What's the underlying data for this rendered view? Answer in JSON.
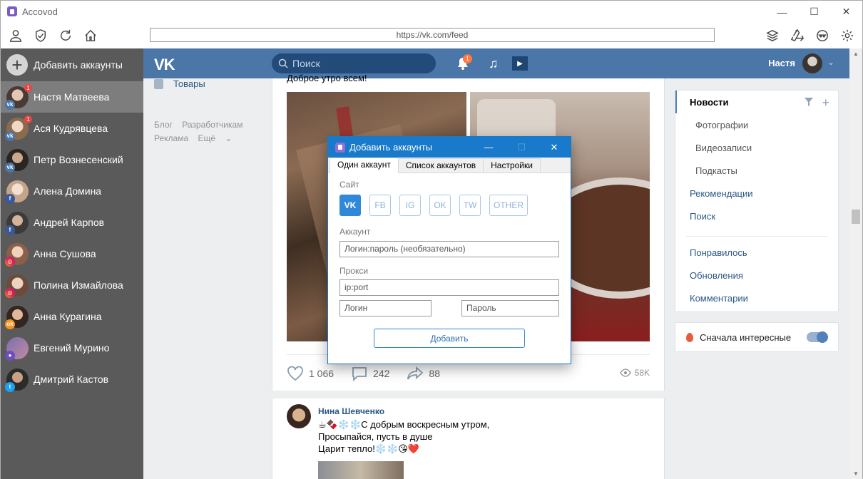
{
  "window": {
    "title": "Accovod"
  },
  "toolbar": {
    "url": "https://vk.com/feed"
  },
  "sidebar": {
    "add_label": "Добавить аккаунты",
    "accounts": [
      {
        "name": "Настя Матвеева",
        "network": "VK",
        "badge": "1"
      },
      {
        "name": "Ася Кудрявцева",
        "network": "VK",
        "badge": "1"
      },
      {
        "name": "Петр Вознесенский",
        "network": "VK"
      },
      {
        "name": "Алена Домина",
        "network": "FB"
      },
      {
        "name": "Андрей Карпов",
        "network": "FB"
      },
      {
        "name": "Анна Сушова",
        "network": "IG"
      },
      {
        "name": "Полина Измайлова",
        "network": "IG"
      },
      {
        "name": "Анна Курагина",
        "network": "OK"
      },
      {
        "name": "Евгений Мурино",
        "network": "OTHER"
      },
      {
        "name": "Дмитрий Кастов",
        "network": "TW"
      }
    ]
  },
  "vk": {
    "search_placeholder": "Поиск",
    "notif_count": "1",
    "user_name": "Настя",
    "left_nav": {
      "goods": "Товары",
      "links": [
        "Блог",
        "Разработчикам",
        "Реклама",
        "Ещё"
      ]
    },
    "post1": {
      "text": "Доброе утро всем!",
      "likes": "1 066",
      "comments": "242",
      "shares": "88",
      "views": "58K"
    },
    "post2": {
      "author": "Нина Шевченко",
      "text": "☕🍫❄️❄️С добрым воскресным утром,\nПросыпайся, пусть в душе\nЦарит тепло!❄️❄️😘❤️"
    },
    "right_menu": {
      "news": "Новости",
      "subs": [
        "Фотографии",
        "Видеозаписи",
        "Подкасты"
      ],
      "main": [
        "Рекомендации",
        "Поиск"
      ],
      "other": [
        "Понравилось",
        "Обновления",
        "Комментарии"
      ]
    },
    "interesting_label": "Сначала интересные"
  },
  "dialog": {
    "title": "Добавить аккаунты",
    "tabs": [
      "Один аккаунт",
      "Список аккаунтов",
      "Настройки"
    ],
    "site_label": "Сайт",
    "sites": [
      "VK",
      "FB",
      "IG",
      "OK",
      "TW",
      "OTHER"
    ],
    "account_label": "Аккаунт",
    "account_placeholder": "Логин:пароль (необязательно)",
    "proxy_label": "Прокси",
    "proxy_placeholder": "ip:port",
    "login_placeholder": "Логин",
    "password_placeholder": "Пароль",
    "submit_label": "Добавить"
  },
  "colors": {
    "vk_blue": "#4a76a8",
    "dialog_blue": "#1979ca",
    "sidebar_bg": "#5a5a5a",
    "active_site": "#2f88d8"
  }
}
